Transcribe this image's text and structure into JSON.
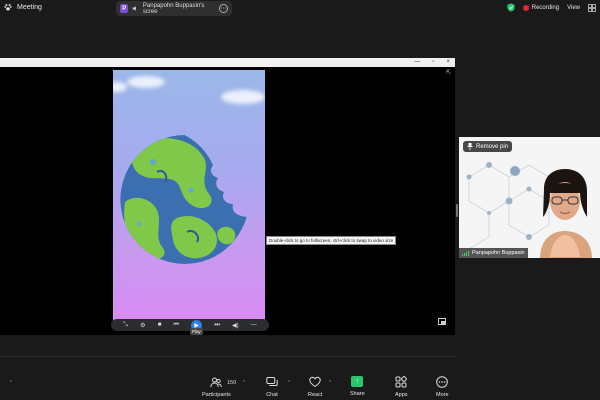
{
  "topbar": {
    "app_title": "Meeting",
    "share_label": "Panpapohn Buppasin's scree",
    "share_badge": "P",
    "recording": "Recording",
    "view": "View"
  },
  "window": {
    "minimize": "—",
    "maximize": "▫",
    "close": "×",
    "expand": "⇱"
  },
  "video_player": {
    "tooltip": "Double-click to go to fullscreen, ctrl+click to swap to video size",
    "play_tip": "Play",
    "controls": [
      "⤡",
      "⚙",
      "■",
      "⏮",
      "▶",
      "⏭",
      "◀)",
      "—"
    ]
  },
  "participant": {
    "remove_pin": "Remove pin",
    "name": "Panpapohn Buppasin"
  },
  "toolbar": {
    "participants_label": "Participants",
    "participants_count": "150",
    "chat_label": "Chat",
    "react_label": "React",
    "share_label": "Share",
    "apps_label": "Apps",
    "more_label": "More"
  },
  "colors": {
    "background": "#1a1a1a",
    "recording_dot": "#e02828",
    "share_green": "#2bc66b",
    "play_blue": "#2d7fe0",
    "earth_land": "#7fc84a",
    "earth_water": "#3b6fb0"
  }
}
